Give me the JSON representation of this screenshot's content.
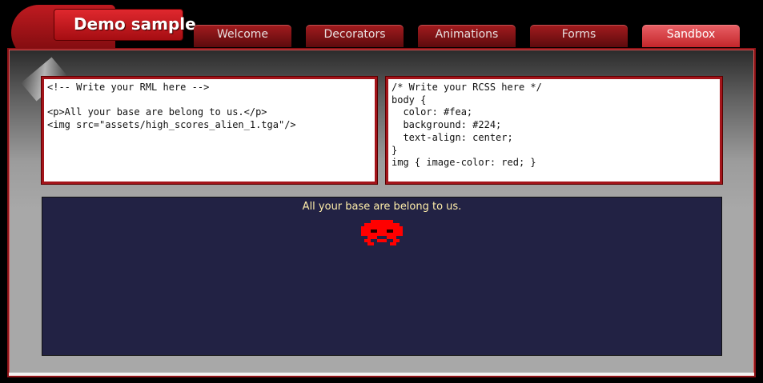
{
  "app": {
    "title": "Demo sample"
  },
  "tabs": [
    {
      "label": "Welcome",
      "active": false
    },
    {
      "label": "Decorators",
      "active": false
    },
    {
      "label": "Animations",
      "active": false
    },
    {
      "label": "Forms",
      "active": false
    },
    {
      "label": "Sandbox",
      "active": true
    }
  ],
  "editors": {
    "rml": "<!-- Write your RML here -->\n\n<p>All your base are belong to us.</p>\n<img src=\"assets/high_scores_alien_1.tga\"/>",
    "rcss": "/* Write your RCSS here */\nbody {\n  color: #fea;\n  background: #224;\n  text-align: center;\n}\nimg { image-color: red; }"
  },
  "preview": {
    "text": "All your base are belong to us.",
    "image_icon": "alien-icon",
    "image_color": "#ff0000",
    "text_color": "#ffeeaa",
    "background_color": "#222244"
  },
  "colors": {
    "accent": "#a3141a",
    "tab_active": "#d23a3f"
  }
}
